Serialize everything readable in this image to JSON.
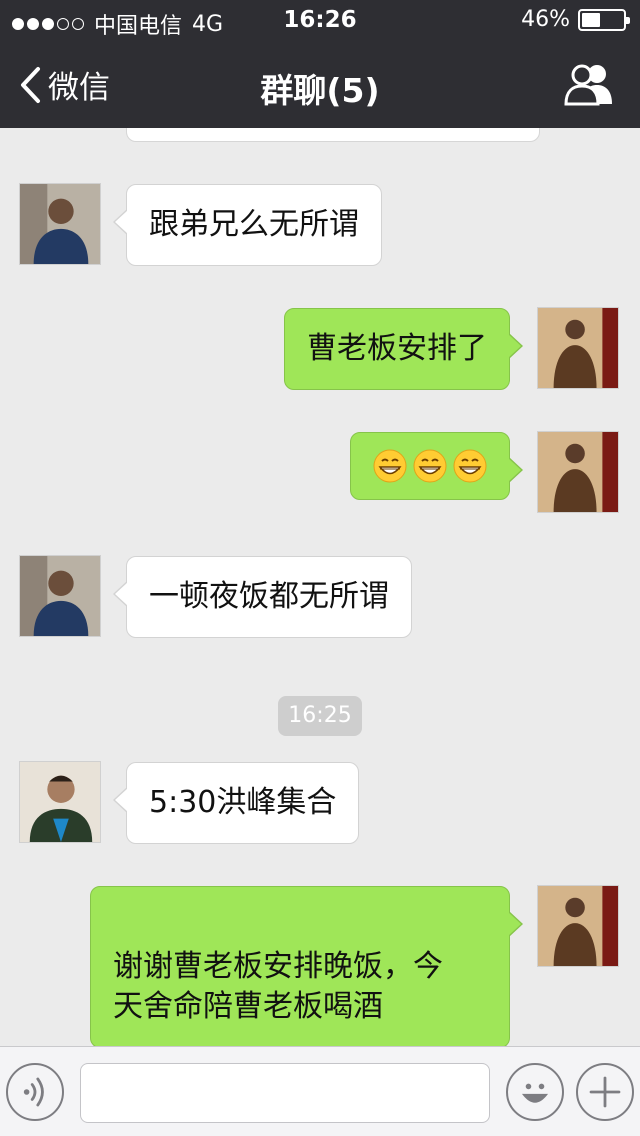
{
  "status_bar": {
    "carrier": "中国电信",
    "network": "4G",
    "time": "16:26",
    "battery_text": "46%",
    "battery_level": 0.46,
    "signal_bars_filled": 3,
    "signal_bars_total": 5
  },
  "nav": {
    "back_label": "微信",
    "title": "群聊(5)",
    "back_icon": "chevron-left-icon",
    "members_icon": "group-members-icon"
  },
  "messages": [
    {
      "side": "in",
      "text": "跟弟兄么无所谓"
    },
    {
      "side": "out",
      "text": "曹老板安排了"
    },
    {
      "side": "out",
      "emoji": [
        "grin-emoji",
        "grin-emoji",
        "grin-emoji"
      ]
    },
    {
      "side": "in",
      "text": "一顿夜饭都无所谓"
    },
    {
      "side": "in",
      "text": "5:30洪峰集合"
    },
    {
      "side": "out",
      "text": "谢谢曹老板安排晚饭，今\n天舍命陪曹老板喝酒"
    }
  ],
  "timestamp_divider": "16:25",
  "input_bar": {
    "voice_icon": "voice-icon",
    "emoji_icon": "smiley-icon",
    "plus_icon": "plus-icon",
    "text_value": ""
  },
  "colors": {
    "nav_bg": "#2e2e33",
    "chat_bg": "#ebebeb",
    "outgoing_bubble": "#9fe658",
    "incoming_bubble": "#ffffff"
  }
}
